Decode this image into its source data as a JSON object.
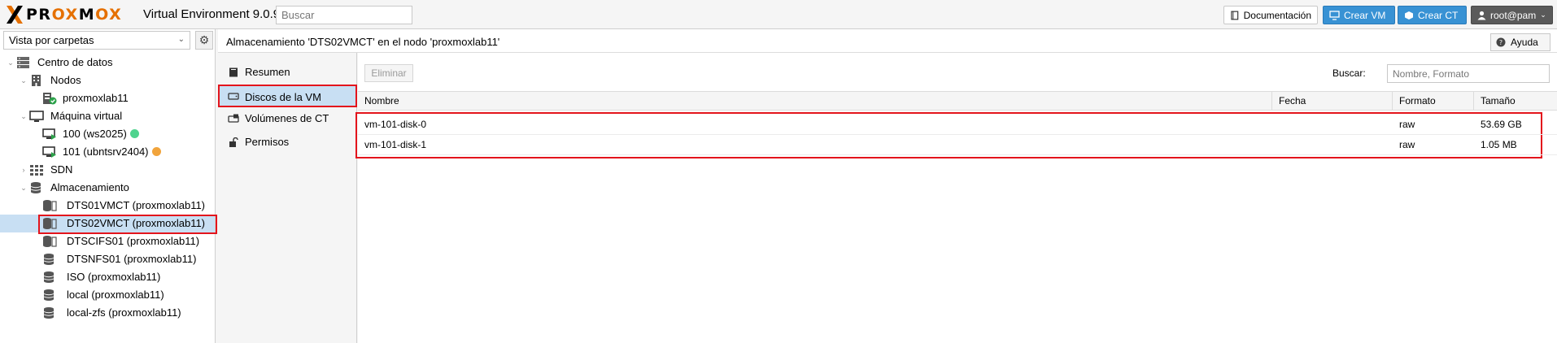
{
  "header": {
    "logo_x": "X",
    "logo_pr": "PR",
    "logo_o1": "O",
    "logo_x2": "X",
    "logo_m": "M",
    "logo_o2": "O",
    "logo_x3": "X",
    "product": "Virtual Environment 9.0.9",
    "search_placeholder": "Buscar",
    "doc_button": "Documentación",
    "create_vm_button": "Crear VM",
    "create_ct_button": "Crear CT",
    "user_button": "root@pam"
  },
  "sidebar": {
    "view_selector": "Vista por carpetas",
    "tree": {
      "datacenter": "Centro de datos",
      "nodes": "Nodos",
      "node": "proxmoxlab11",
      "vms_folder": "Máquina virtual",
      "vm1": "100 (ws2025)",
      "vm2": "101 (ubntsrv2404)",
      "sdn": "SDN",
      "storage_folder": "Almacenamiento",
      "storages": [
        "DTS01VMCT (proxmoxlab11)",
        "DTS02VMCT (proxmoxlab11)",
        "DTSCIFS01 (proxmoxlab11)",
        "DTSNFS01 (proxmoxlab11)",
        "ISO (proxmoxlab11)",
        "local (proxmoxlab11)",
        "local-zfs (proxmoxlab11)"
      ]
    }
  },
  "content_header": {
    "title": "Almacenamiento 'DTS02VMCT' en el nodo 'proxmoxlab11'",
    "help_button": "Ayuda"
  },
  "menu": {
    "items": [
      "Resumen",
      "Discos de la VM",
      "Volúmenes de CT",
      "Permisos"
    ]
  },
  "toolbar": {
    "delete_button": "Eliminar",
    "search_label": "Buscar:",
    "search_placeholder": "Nombre, Formato"
  },
  "grid": {
    "columns": [
      "Nombre",
      "Fecha",
      "Formato",
      "Tamaño"
    ],
    "rows": [
      {
        "name": "vm-101-disk-0",
        "date": "",
        "format": "raw",
        "size": "53.69 GB"
      },
      {
        "name": "vm-101-disk-1",
        "date": "",
        "format": "raw",
        "size": "1.05 MB"
      }
    ]
  },
  "colors": {
    "accent_blue": "#3892d4",
    "logo_orange": "#e57000",
    "selection": "#c8dff3",
    "highlight_red": "#e3141c",
    "status_running": "#4fd38e",
    "status_warning": "#f1a43c"
  }
}
